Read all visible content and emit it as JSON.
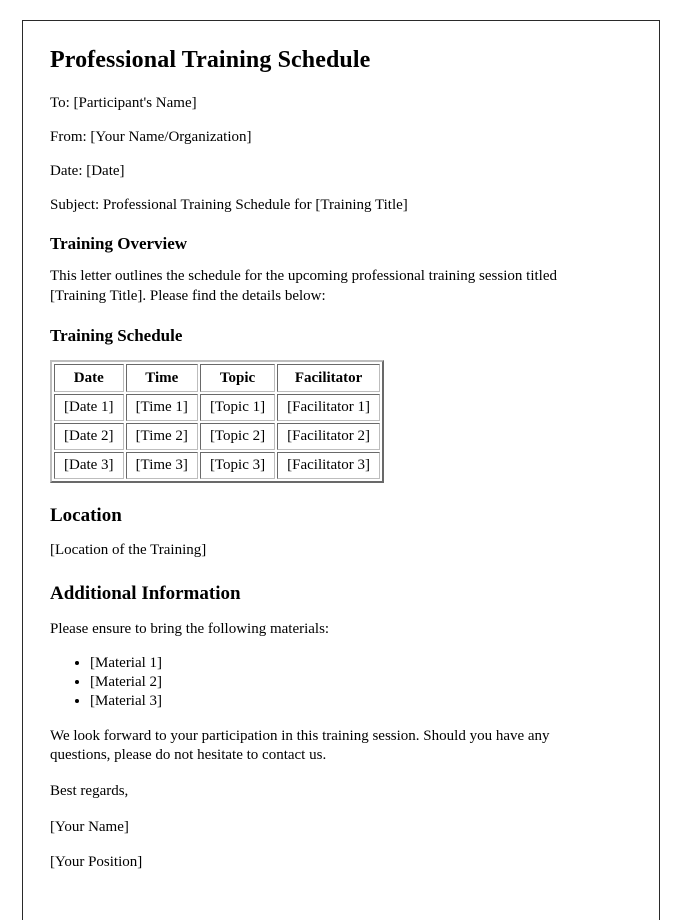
{
  "document": {
    "title": "Professional Training Schedule",
    "meta": [
      {
        "key": "to",
        "text": "To: [Participant's Name]"
      },
      {
        "key": "from",
        "text": "From: [Your Name/Organization]"
      },
      {
        "key": "date",
        "text": "Date: [Date]"
      },
      {
        "key": "subject",
        "text": "Subject: Professional Training Schedule for [Training Title]"
      }
    ],
    "overview": {
      "heading": "Training Overview",
      "paragraph": "This letter outlines the schedule for the upcoming professional training session titled [Training Title]. Please find the details below:"
    },
    "schedule": {
      "heading": "Training Schedule",
      "columns": [
        "Date",
        "Time",
        "Topic",
        "Facilitator"
      ],
      "rows": [
        [
          "[Date 1]",
          "[Time 1]",
          "[Topic 1]",
          "[Facilitator 1]"
        ],
        [
          "[Date 2]",
          "[Time 2]",
          "[Topic 2]",
          "[Facilitator 2]"
        ],
        [
          "[Date 3]",
          "[Time 3]",
          "[Topic 3]",
          "[Facilitator 3]"
        ]
      ]
    },
    "location": {
      "heading": "Location",
      "text": "[Location of the Training]"
    },
    "additional": {
      "heading": "Additional Information",
      "intro": "Please ensure to bring the following materials:",
      "materials": [
        "[Material 1]",
        "[Material 2]",
        "[Material 3]"
      ]
    },
    "closing": {
      "paragraph": "We look forward to your participation in this training session. Should you have any questions, please do not hesitate to contact us.",
      "salutation": "Best regards,",
      "name": "[Your Name]",
      "position": "[Your Position]"
    }
  }
}
